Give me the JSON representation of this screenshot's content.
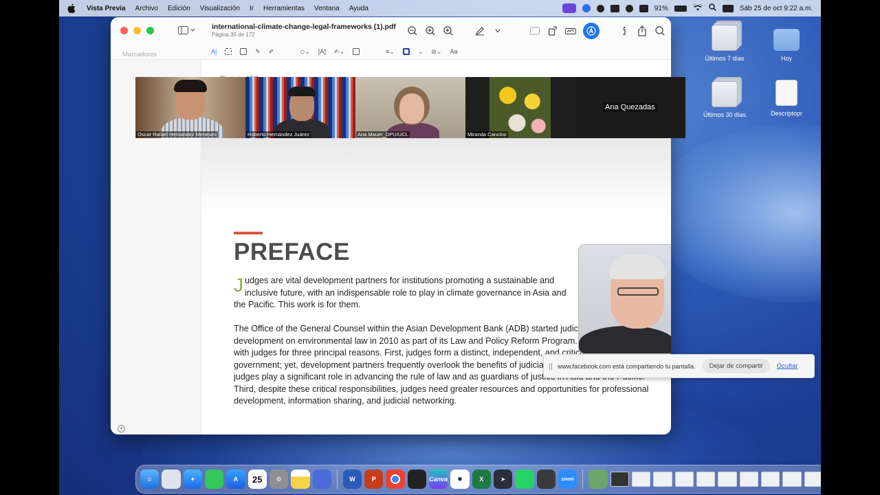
{
  "menubar": {
    "app": "Vista Previa",
    "items": [
      "Archivo",
      "Edición",
      "Visualización",
      "Ir",
      "Herramientas",
      "Ventana",
      "Ayuda"
    ],
    "battery": "91%",
    "datetime": "Sáb 25 de oct  9:22 a.m."
  },
  "desktop": [
    {
      "label": "Últimos 7 días",
      "kind": "stack"
    },
    {
      "label": "Hoy",
      "kind": "folder"
    },
    {
      "label": "Últimos 30 días",
      "kind": "stack"
    },
    {
      "label": "Descriptopr",
      "kind": "doc"
    }
  ],
  "window": {
    "title": "international-climate-change-legal-frameworks (1).pdf",
    "subtitle": "Página 35 de 172",
    "sidebar_label": "Marcadores",
    "font_menu": "Aa"
  },
  "document": {
    "photo_credit": "Photo by ADB.",
    "heading": "PREFACE",
    "drop_cap": "J",
    "para1": "udges are vital development partners for institutions promoting a sustainable and inclusive future, with an indispensable role to play in climate governance in Asia and the Pacific. This work is for them.",
    "para2": "The Office of the General Counsel within the Asian Development Bank (ADB) started judicial capacity development on environmental law in 2010 as part of its Law and Policy Reform Program. ADB chose to work with judges for three principal reasons. First, judges form a distinct, independent, and critical branch of government; yet, development partners frequently overlook the benefits of judicial capacity building. Second, judges play a significant role in advancing the rule of law and as guardians of justice in Asia and the Pacific. Third, despite these critical responsibilities, judges need greater resources and opportunities for professional development, information sharing, and judicial networking."
  },
  "meeting": {
    "participants": [
      "Oscar Rafael Hernandez Meneses",
      "Roberto Hernández Juárez",
      "Ana Mauer_DPU/UCL",
      "Miranda Cancino",
      "Ana Quezadas"
    ]
  },
  "share_banner": {
    "message": "www.facebook.com está compartiendo tu pantalla.",
    "stop_label": "Dejar de compartir",
    "hide_label": "Ocultar"
  },
  "dock": {
    "calendar_day": "25",
    "canva_label": "Canva",
    "zoom_label": "zoom"
  }
}
